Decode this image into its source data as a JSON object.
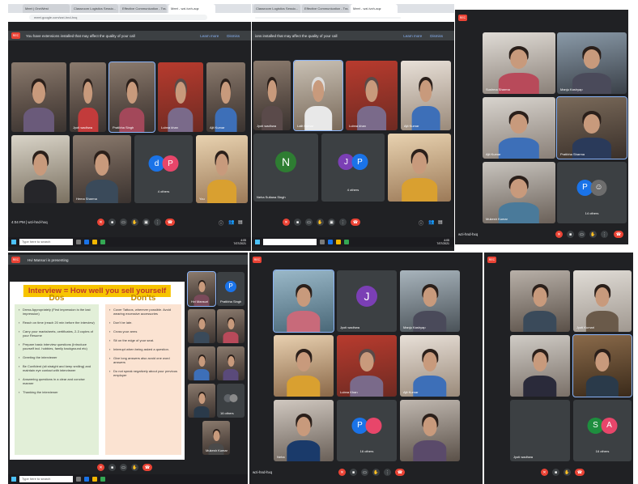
{
  "collage": {
    "panel1": {
      "browser_tabs": [
        "Meet | OneWest",
        "Classroom Logistics Sessio...",
        "Effective Communication - Tra...",
        "Meet - wzi-tvzh-aqz"
      ],
      "url": "meet.google.com/wzi-hnd-hxq",
      "warning": "You have extensions installed that may affect the quality of your call",
      "learn_more": "Learn more",
      "dismiss": "Dismiss",
      "tiles": [
        {
          "name": "",
          "type": "video"
        },
        {
          "name": "Jyoti wadhwa",
          "type": "video"
        },
        {
          "name": "Pratibha Singh",
          "type": "video"
        },
        {
          "name": "Lubna khan",
          "type": "video"
        },
        {
          "name": "Ajit Kumar",
          "type": "video"
        },
        {
          "name": "",
          "type": "video"
        },
        {
          "name": "Hema Sharma",
          "type": "video"
        },
        {
          "name": "4 others",
          "type": "others",
          "letters": [
            "d",
            "P"
          ],
          "colors": [
            "#1a73e8",
            "#e8466a"
          ]
        },
        {
          "name": "You",
          "type": "video"
        }
      ],
      "time": "4:04 PM | wzi-hnd-hxq",
      "search": "Type here to search",
      "clock_time": "4:05",
      "clock_date": "7/07/2021"
    },
    "panel2": {
      "browser_tabs": [
        "Classroom Logistics Sessio...",
        "Effective Communication - Tra...",
        "Meet - wzi-tvzh-aqz"
      ],
      "warning": "ions installed that may affect the quality of your call",
      "learn_more": "Learn more",
      "dismiss": "Dismiss",
      "tiles": [
        {
          "name": "Jyoti wadhwa",
          "type": "video"
        },
        {
          "name": "Lalit Kumar",
          "type": "video"
        },
        {
          "name": "Lubna khan",
          "type": "video"
        },
        {
          "name": "Ajit Kumar",
          "type": "video"
        },
        {
          "name": "Neha Sultana Singh",
          "type": "avatar",
          "letter": "N",
          "color": "#2e7d32"
        },
        {
          "name": "4 others",
          "type": "others",
          "letters": [
            "J",
            "P"
          ],
          "colors": [
            "#7b3fb5",
            "#1a73e8"
          ]
        },
        {
          "name": "",
          "type": "video"
        }
      ],
      "clock_time": "4:05",
      "clock_date": "7/07/2021"
    },
    "panel3": {
      "tiles": [
        {
          "name": "Sushma Sharma",
          "type": "video"
        },
        {
          "name": "Manju Kashyap",
          "type": "video"
        },
        {
          "name": "Ajit Kumar",
          "type": "video"
        },
        {
          "name": "Pratibha Sharma",
          "type": "video"
        },
        {
          "name": "Mukesh Kumar",
          "type": "video"
        },
        {
          "name": "14 others",
          "type": "others",
          "letters": [
            "P",
            "☺"
          ],
          "colors": [
            "#1a73e8",
            "#6d6d6d"
          ]
        }
      ],
      "meeting_code": "wzi-hnd-hxq"
    },
    "panel4": {
      "presenting": "Hvi Mansuri is presenting",
      "slide": {
        "title": "Interview = How well you sell yourself",
        "dos_head": "Dos",
        "donts_head": "Don'ts",
        "dos": [
          "Dress Appropriately (First impression is the last impression)",
          "Reach on time (reach 20 min before the interview)",
          "Carry your marksheets, certificates, 2-3 copies of your Resume",
          "Prepare basic interview questions (Introduce yourself incl. hobbies, family background etc)",
          "Greeting the interviewer",
          "Be Confident (sit straight and keep smiling) and maintain eye contact with interviewer",
          "Answering questions in a clear and concise manner",
          "Thanking the interviewer"
        ],
        "donts": [
          "Cover Tattoos, wherever possible. Avoid wearing excessive accessories",
          "Don't be late.",
          "Cross your arms",
          "Sit on the edge of your seat.",
          "Interrupt when being asked a question.",
          "Give long answers also avoid one word answers",
          "Do not speak negatively about your previous employer"
        ]
      },
      "side_tiles": [
        {
          "name": "Hvi Mansuri",
          "type": "video"
        },
        {
          "name": "Pratibha Singh",
          "type": "avatar",
          "letter": "P",
          "color": "#1a73e8"
        },
        {
          "name": "",
          "type": "video"
        },
        {
          "name": "",
          "type": "video"
        },
        {
          "name": "",
          "type": "video"
        },
        {
          "name": "",
          "type": "video"
        },
        {
          "name": "",
          "type": "video"
        },
        {
          "name": "16 others",
          "type": "others",
          "letters": [
            "",
            ""
          ],
          "colors": [
            "#5f6368",
            "#5f6368"
          ]
        },
        {
          "name": "Mukesh Kumar",
          "type": "video"
        }
      ],
      "search": "Type here to search"
    },
    "panel5": {
      "tiles": [
        {
          "name": "",
          "type": "video"
        },
        {
          "name": "Jyoti wadhwa",
          "type": "avatar",
          "letter": "J",
          "color": "#7b3fb5"
        },
        {
          "name": "Manju Kashyap",
          "type": "video"
        },
        {
          "name": "",
          "type": "video"
        },
        {
          "name": "Lubna Khan",
          "type": "video"
        },
        {
          "name": "Ajit Kumar",
          "type": "video"
        },
        {
          "name": "Neha",
          "type": "video"
        },
        {
          "name": "16 others",
          "type": "others",
          "letters": [
            "P",
            ""
          ],
          "colors": [
            "#1a73e8",
            "#e8466a"
          ]
        },
        {
          "name": "",
          "type": "video"
        }
      ],
      "meeting_code": "wzi-hnd-hxq"
    },
    "panel6": {
      "tiles": [
        {
          "name": "",
          "type": "video"
        },
        {
          "name": "Jyoti Kumari",
          "type": "video"
        },
        {
          "name": "",
          "type": "video"
        },
        {
          "name": "",
          "type": "video"
        },
        {
          "name": "Jyoti wadhwa",
          "type": "dark"
        },
        {
          "name": "16 others",
          "type": "others",
          "letters": [
            "S",
            "A"
          ],
          "colors": [
            "#1e8e3e",
            "#e8466a"
          ]
        }
      ]
    }
  }
}
